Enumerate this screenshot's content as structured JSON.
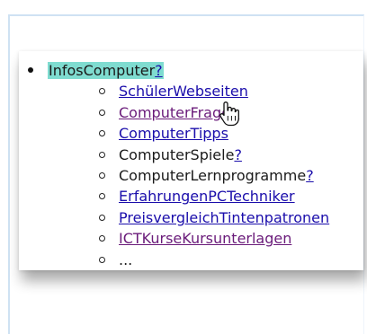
{
  "menu": {
    "top_item": {
      "label": "InfosComputer",
      "question_mark": "?",
      "highlight_color": "#7fdcd0"
    },
    "sub_items": [
      {
        "label": "SchülerWebseiten",
        "type": "link",
        "visited": false
      },
      {
        "label": "ComputerFragen",
        "type": "link",
        "visited": true
      },
      {
        "label": "ComputerTipps",
        "type": "link",
        "visited": false
      },
      {
        "label": "ComputerSpiele",
        "type": "missing",
        "question_mark": "?"
      },
      {
        "label": "ComputerLernprogramme",
        "type": "missing",
        "question_mark": "?"
      },
      {
        "label": "ErfahrungenPCTechniker",
        "type": "link",
        "visited": false
      },
      {
        "label": "PreisvergleichTintenpatronen",
        "type": "link",
        "visited": false
      },
      {
        "label": "ICTKurseKursunterlagen",
        "type": "link",
        "visited": true
      },
      {
        "label": "...",
        "type": "text"
      }
    ]
  },
  "colors": {
    "link": "#1a0dab",
    "visited_link": "#6a1b7a",
    "text": "#1a1a1a",
    "frame_border": "#cfe2f3"
  },
  "cursor": {
    "icon": "hand-pointer-icon",
    "hovering": "ComputerFragen"
  }
}
